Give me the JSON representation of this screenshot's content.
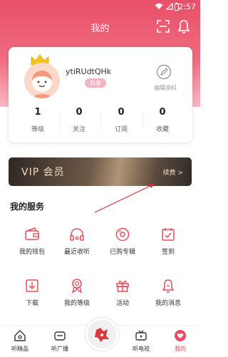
{
  "status_bar": {
    "time": "2:57"
  },
  "header": {
    "title": "我的"
  },
  "profile": {
    "username": "ytiRUdtQHk",
    "level_badge": "白身",
    "edit_label": "编辑资料",
    "stats": [
      {
        "value": "1",
        "label": "等级"
      },
      {
        "value": "0",
        "label": "关注"
      },
      {
        "value": "0",
        "label": "订阅"
      },
      {
        "value": "0",
        "label": "收藏"
      }
    ]
  },
  "vip": {
    "title": "VIP 会员",
    "renew": "续费 >"
  },
  "services": {
    "title": "我的服务",
    "items": [
      {
        "label": "我的钱包",
        "icon": "wallet-icon"
      },
      {
        "label": "最近收听",
        "icon": "headphones-icon"
      },
      {
        "label": "已购专辑",
        "icon": "disc-icon"
      },
      {
        "label": "签到",
        "icon": "calendar-check-icon"
      },
      {
        "label": "下载",
        "icon": "download-icon"
      },
      {
        "label": "我的等级",
        "icon": "medal-icon"
      },
      {
        "label": "活动",
        "icon": "gift-icon"
      },
      {
        "label": "我的消息",
        "icon": "message-bell-icon"
      }
    ]
  },
  "tabbar": {
    "tabs": [
      {
        "label": "听精品",
        "icon": "home-icon"
      },
      {
        "label": "听广播",
        "icon": "radio-icon"
      },
      {
        "label": "听电视",
        "icon": "tv-icon"
      },
      {
        "label": "我的",
        "icon": "profile-heart-icon"
      }
    ]
  },
  "colors": {
    "accent": "#e94a5f",
    "header": "#e8506a",
    "vip_text": "#f0dcc0"
  }
}
